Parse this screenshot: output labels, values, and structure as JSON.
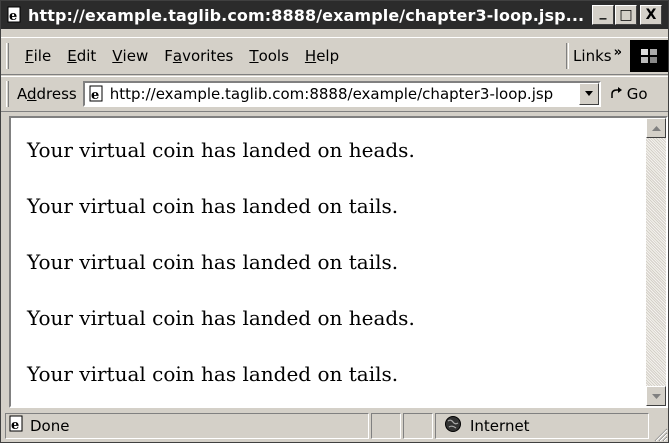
{
  "window": {
    "title": "http://example.taglib.com:8888/example/chapter3-loop.jsp...",
    "minimize": "_",
    "maximize": "□",
    "close": "X"
  },
  "menubar": {
    "items": [
      {
        "accel": "F",
        "rest": "ile"
      },
      {
        "accel": "E",
        "rest": "dit"
      },
      {
        "accel": "V",
        "rest": "iew"
      },
      {
        "pre": "F",
        "accel": "a",
        "rest": "vorites"
      },
      {
        "accel": "T",
        "rest": "ools"
      },
      {
        "accel": "H",
        "rest": "elp"
      }
    ],
    "links_label": "Links",
    "links_chevron": "»"
  },
  "addressbar": {
    "label_pre": "A",
    "label_accel": "d",
    "label_rest": "dress",
    "url": "http://example.taglib.com:8888/example/chapter3-loop.jsp",
    "go_label": "Go"
  },
  "content": {
    "lines": [
      "Your virtual coin has landed on heads.",
      "Your virtual coin has landed on tails.",
      "Your virtual coin has landed on tails.",
      "Your virtual coin has landed on heads.",
      "Your virtual coin has landed on tails."
    ]
  },
  "statusbar": {
    "status": "Done",
    "zone": "Internet"
  }
}
